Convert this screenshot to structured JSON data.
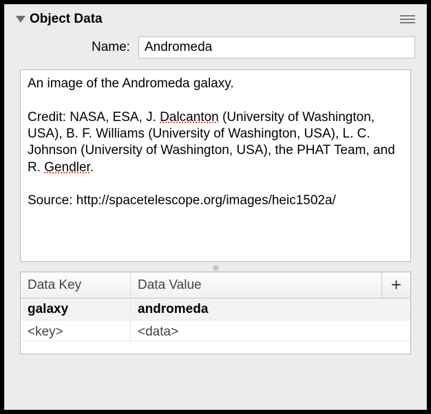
{
  "panel": {
    "title": "Object Data"
  },
  "name": {
    "label": "Name:",
    "value": "Andromeda"
  },
  "description": {
    "line1": "An image of the Andromeda galaxy.",
    "credit_prefix": "Credit: NASA, ESA, J. ",
    "spell1": "Dalcanton",
    "credit_mid": " (University of Washington, USA), B. F. Williams (University of Washington, USA), L. C. Johnson (University of Washington, USA), the PHAT Team, and R. ",
    "spell2": "Gendler",
    "credit_end": ".",
    "source": "Source: http://spacetelescope.org/images/heic1502a/"
  },
  "table": {
    "headers": {
      "key": "Data Key",
      "value": "Data Value"
    },
    "rows": [
      {
        "key": "galaxy",
        "value": "andromeda"
      }
    ],
    "placeholder": {
      "key": "<key>",
      "value": "<data>"
    },
    "add_label": "+"
  }
}
